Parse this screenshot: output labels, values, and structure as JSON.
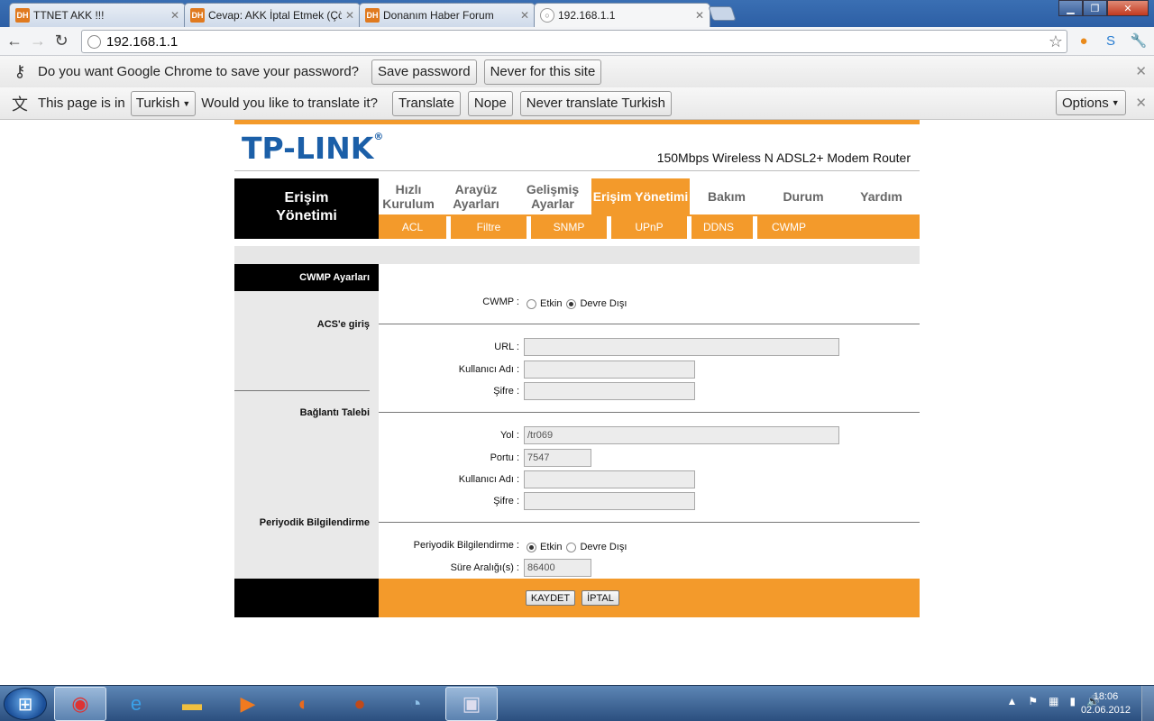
{
  "browser": {
    "tabs": [
      {
        "title": "TTNET AKK !!!",
        "favicon": "DH"
      },
      {
        "title": "Cevap: AKK İptal Etmek (Çö",
        "favicon": "DH"
      },
      {
        "title": "Donanım Haber Forum",
        "favicon": "DH"
      },
      {
        "title": "192.168.1.1",
        "favicon": "globe-icon"
      }
    ],
    "address": "192.168.1.1",
    "password_bar": {
      "prompt": "Do you want Google Chrome to save your password?",
      "save": "Save password",
      "never": "Never for this site"
    },
    "translate_bar": {
      "prefix": "This page is in",
      "language": "Turkish",
      "question": "Would you like to translate it?",
      "translate": "Translate",
      "nope": "Nope",
      "never": "Never translate Turkish",
      "options": "Options"
    }
  },
  "router": {
    "logo": "TP-LINK",
    "logo_mark": "®",
    "model": "150Mbps Wireless N ADSL2+ Modem Router",
    "section_title_line1": "Erişim",
    "section_title_line2": "Yönetimi",
    "main_nav": [
      {
        "line1": "Hızlı",
        "line2": "Kurulum"
      },
      {
        "line1": "Arayüz",
        "line2": "Ayarları"
      },
      {
        "line1": "Gelişmiş",
        "line2": "Ayarlar"
      },
      {
        "line1": "Erişim Yönetimi",
        "line2": ""
      },
      {
        "line1": "Bakım",
        "line2": ""
      },
      {
        "line1": "Durum",
        "line2": ""
      },
      {
        "line1": "Yardım",
        "line2": ""
      }
    ],
    "sub_nav": [
      "ACL",
      "Filtre",
      "SNMP",
      "UPnP",
      "DDNS",
      "CWMP"
    ],
    "cwmp_header": "CWMP Ayarları",
    "acs_header": "ACS'e giriş",
    "conn_header": "Bağlantı Talebi",
    "periodic_header": "Periyodik Bilgilendirme",
    "cwmp": {
      "label": "CWMP :",
      "opt_on": "Etkin",
      "opt_off": "Devre Dışı",
      "selected": "off"
    },
    "acs": {
      "url_label": "URL :",
      "url_value": "",
      "user_label": "Kullanıcı Adı :",
      "user_value": "",
      "pass_label": "Şifre :",
      "pass_value": ""
    },
    "conn": {
      "path_label": "Yol :",
      "path_value": "/tr069",
      "port_label": "Portu :",
      "port_value": "7547",
      "user_label": "Kullanıcı Adı :",
      "user_value": "",
      "pass_label": "Şifre :",
      "pass_value": ""
    },
    "periodic": {
      "label": "Periyodik Bilgilendirme :",
      "opt_on": "Etkin",
      "opt_off": "Devre Dışı",
      "selected": "on",
      "interval_label": "Süre Aralığı(s) :",
      "interval_value": "86400"
    },
    "buttons": {
      "save": "KAYDET",
      "cancel": "İPTAL"
    }
  },
  "taskbar": {
    "time": "18:06",
    "date": "02.06.2012"
  }
}
